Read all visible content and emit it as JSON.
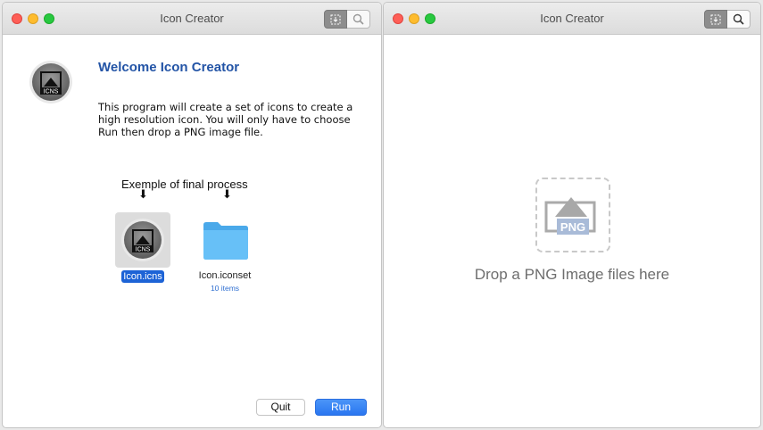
{
  "left_window": {
    "title": "Icon Creator",
    "welcome_title": "Welcome Icon Creator",
    "description": "This program will create a set of icons to create a high resolution icon. You will only have to choose Run then drop a PNG image file.",
    "example_caption": "Exemple of final process",
    "arrow_glyph": "⬇",
    "app_icon_label": "ICNS",
    "files": [
      {
        "name": "Icon.icns",
        "selected": true
      },
      {
        "name": "Icon.iconset",
        "subtitle": "10 items"
      }
    ],
    "buttons": {
      "quit": "Quit",
      "run": "Run"
    }
  },
  "right_window": {
    "title": "Icon Creator",
    "png_badge": "PNG",
    "drop_text": "Drop a PNG Image files here"
  },
  "colors": {
    "accent": "#2354a6",
    "selection": "#1d63d6",
    "run_button": "#2a76f0",
    "folder": "#5ab8f4"
  },
  "icons": [
    "app-icns-icon",
    "folder-icon",
    "png-image-icon",
    "arrow-down-icon",
    "search-icon",
    "capture-icon"
  ]
}
